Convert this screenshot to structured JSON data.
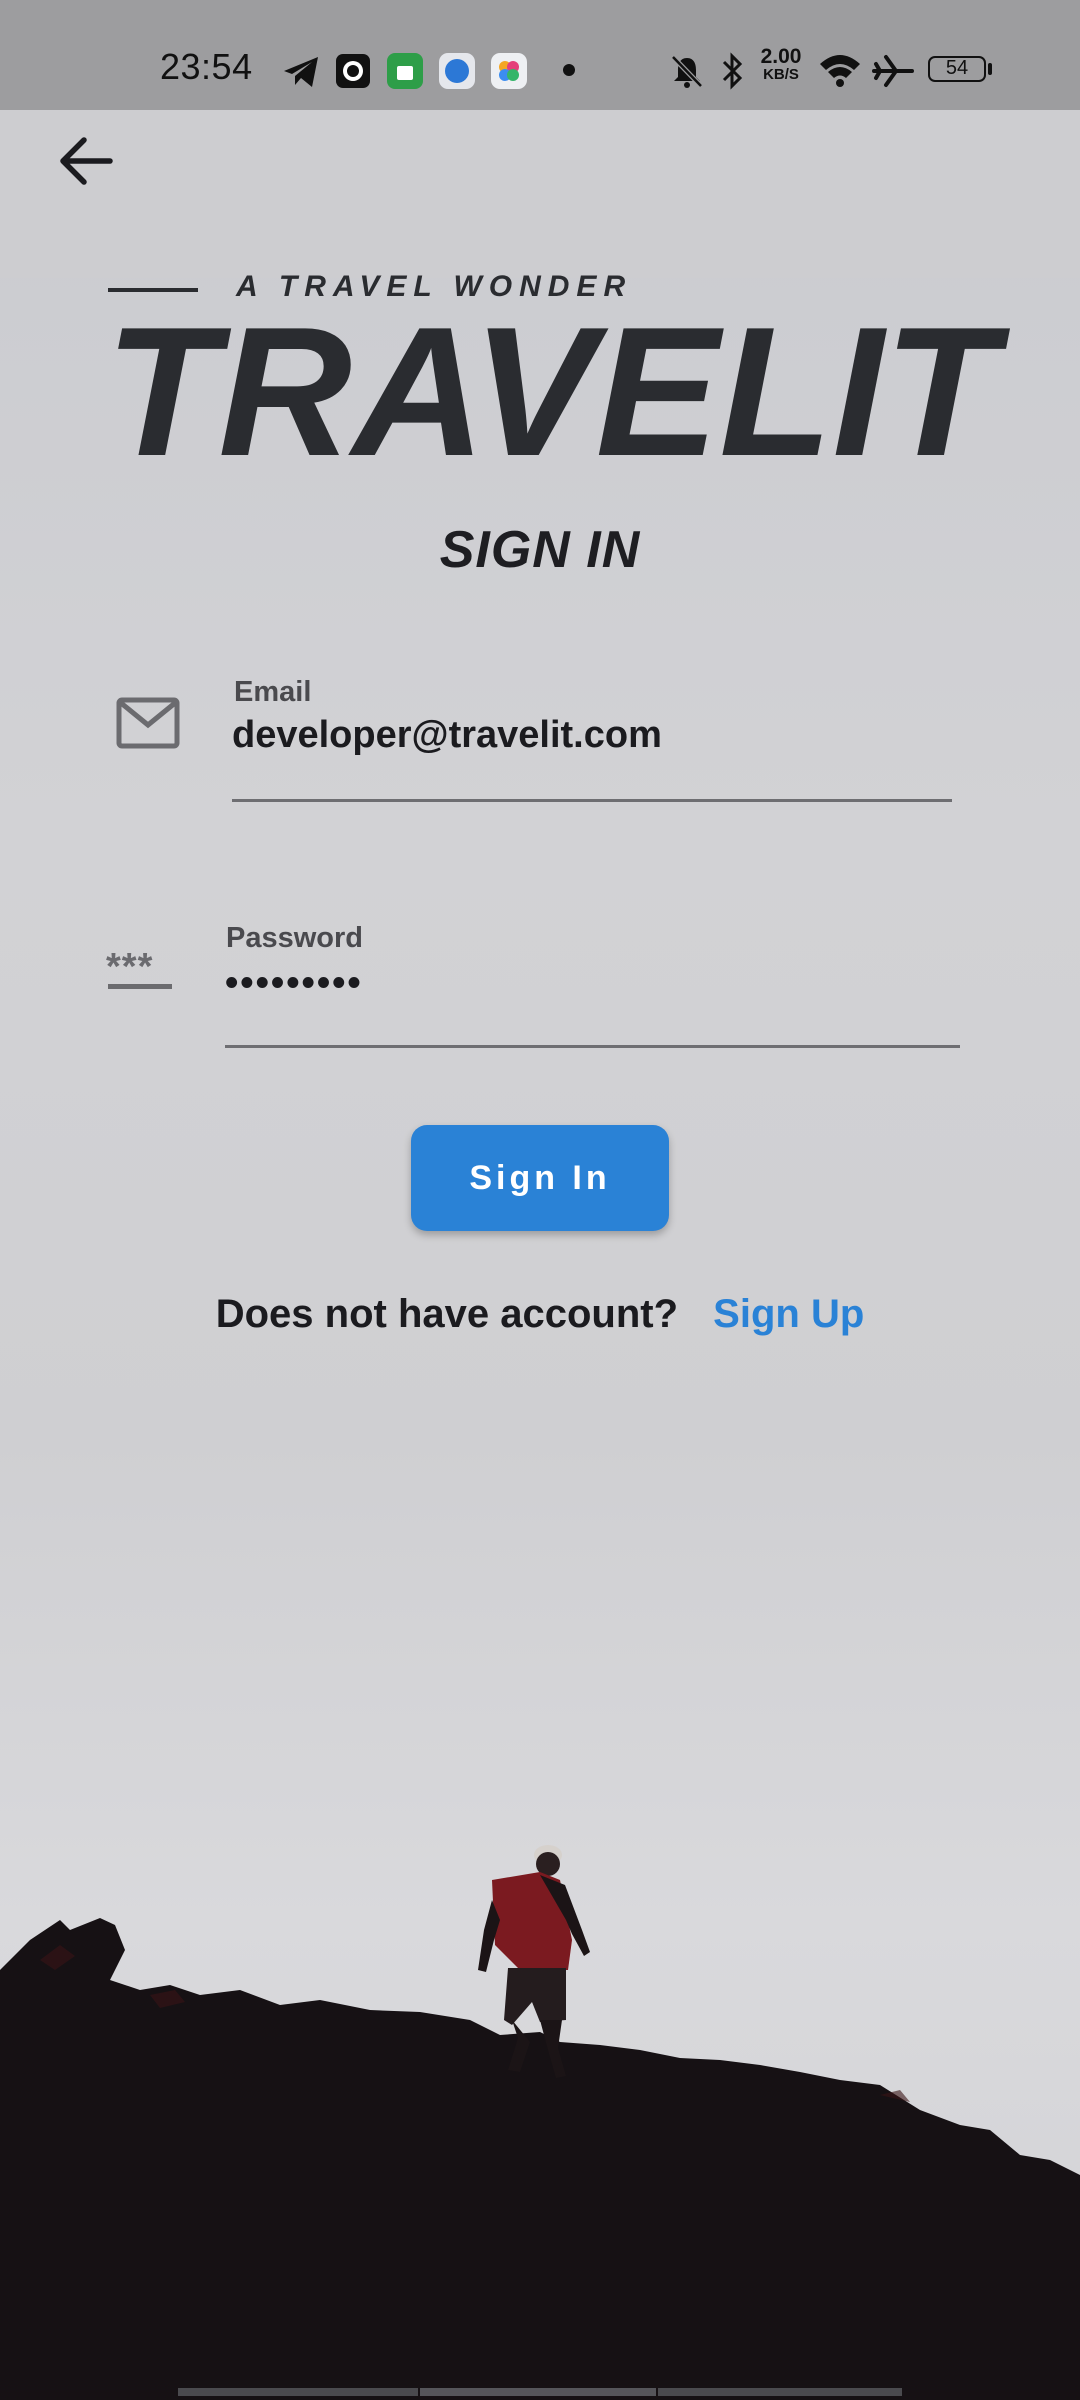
{
  "status_bar": {
    "time": "23:54",
    "network_speed_value": "2.00",
    "network_speed_unit": "KB/S",
    "battery_level": "54",
    "icons": [
      "telegram-icon",
      "camera-app-icon",
      "store-app-icon",
      "browser-app-icon",
      "photos-app-icon",
      "notification-dot-icon",
      "mute-icon",
      "bluetooth-icon",
      "wifi-icon",
      "airplane-mode-icon",
      "battery-icon"
    ]
  },
  "app_bar": {
    "back_icon": "arrow-left-icon"
  },
  "brand": {
    "tagline": "A TRAVEL WONDER",
    "name": "TRAVELIT"
  },
  "form": {
    "title": "SIGN IN",
    "email": {
      "label": "Email",
      "value": "developer@travelit.com",
      "icon": "mail-icon"
    },
    "password": {
      "label": "Password",
      "value": "•••••••••",
      "icon": "password-icon"
    },
    "submit_label": "Sign In",
    "signup_prompt": "Does not have account?",
    "signup_link": "Sign Up"
  },
  "colors": {
    "accent": "#2a82d6",
    "text_dark": "#1e1e22",
    "background": "#cfcfd2"
  }
}
